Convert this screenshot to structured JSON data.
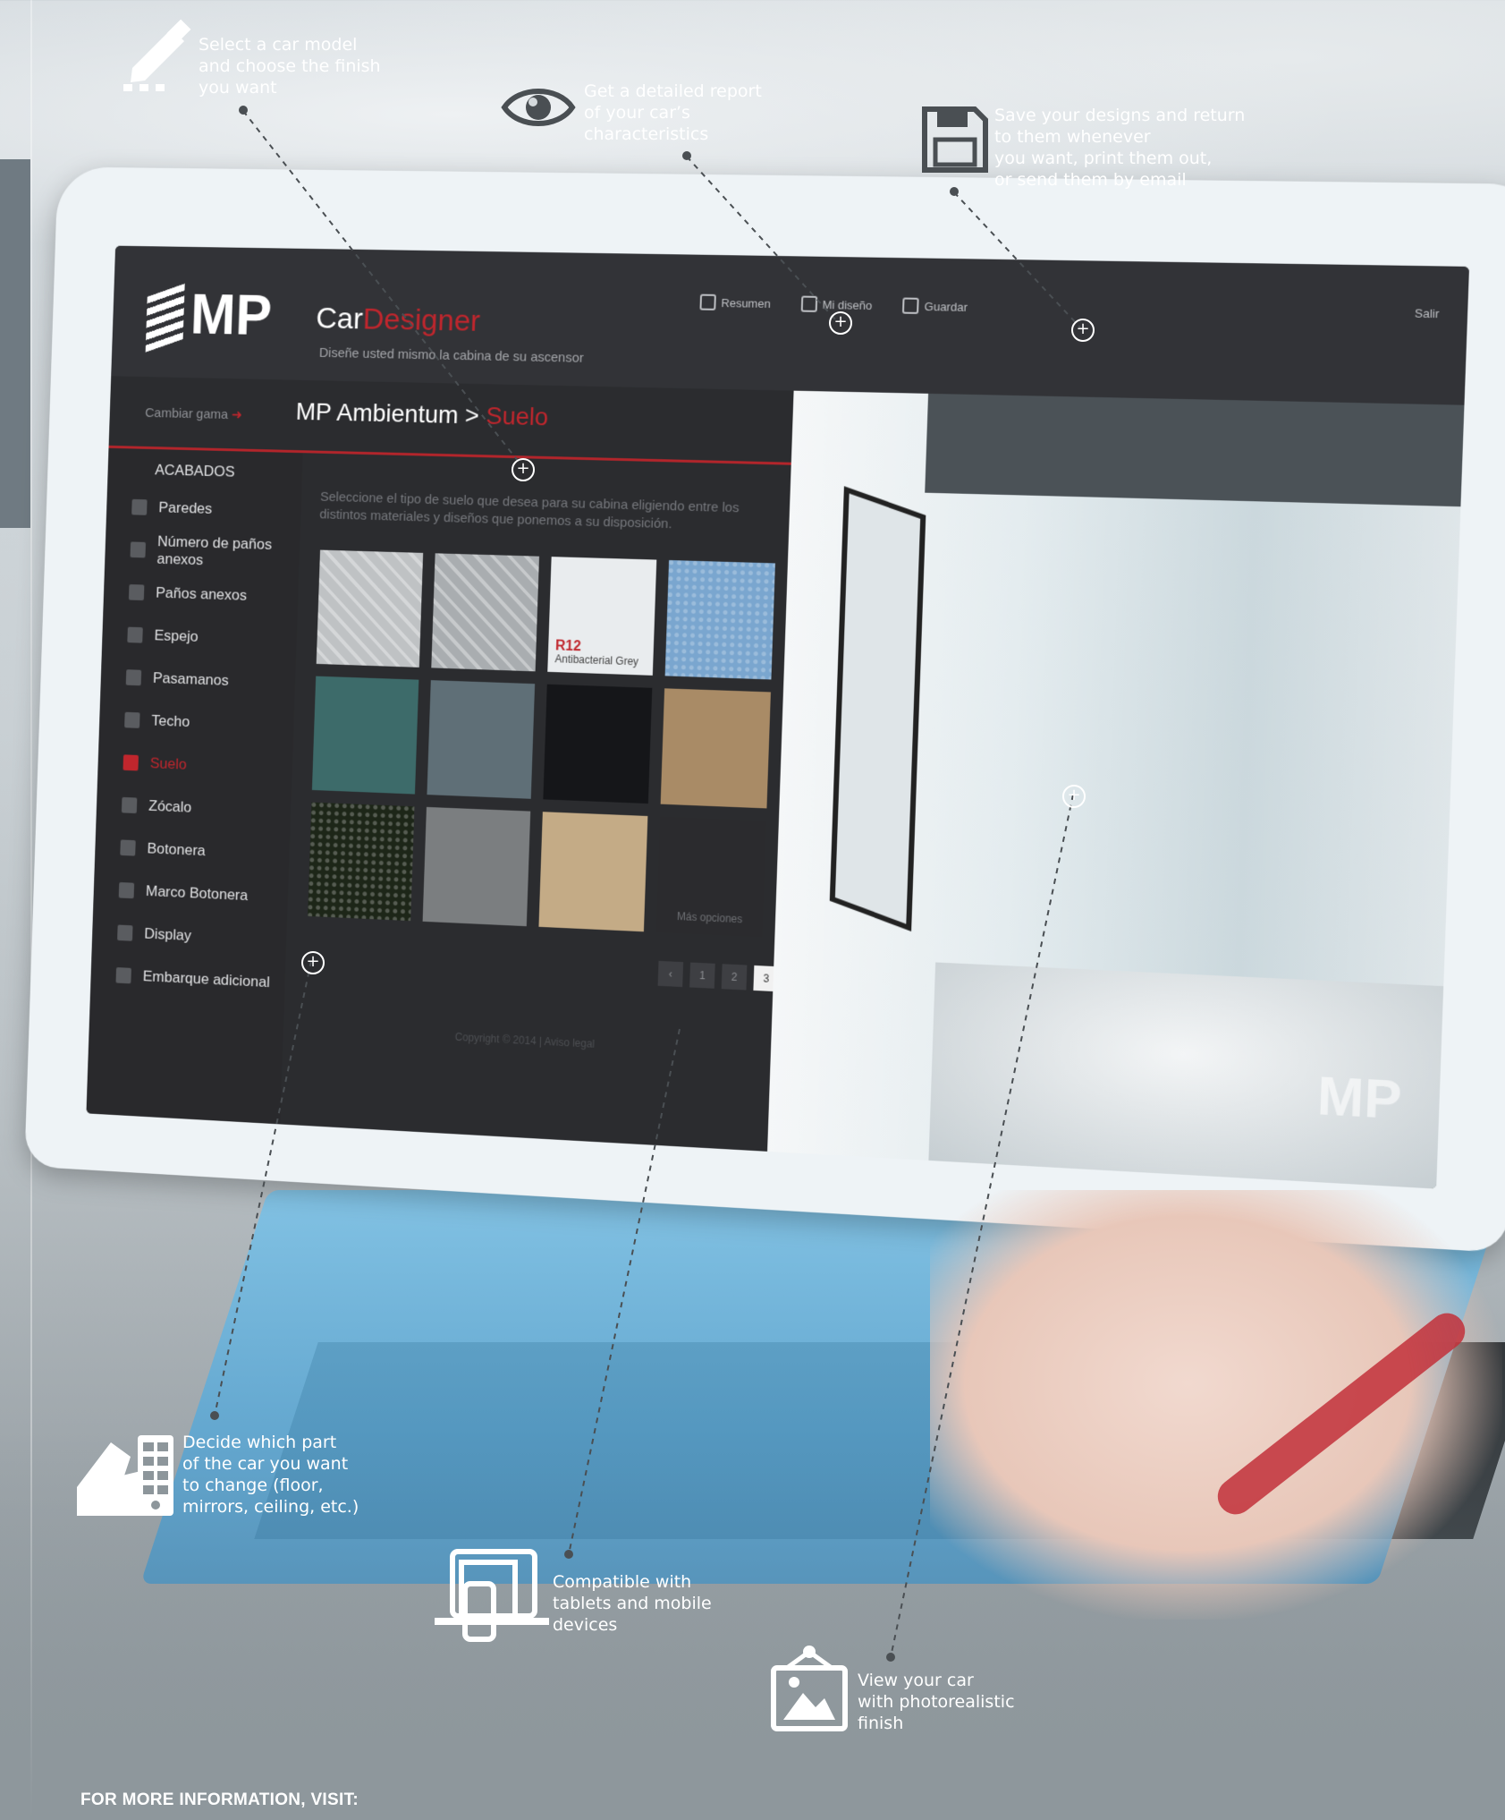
{
  "app": {
    "logo_text": "MP",
    "title_prefix": "Car",
    "title_accent": "Designer",
    "subtitle": "Diseñe usted mismo la cabina de su ascensor",
    "actions": [
      "Resumen",
      "Mi diseño",
      "Guardar"
    ],
    "exit_label": "Salir",
    "range_change_label": "Cambiar gama",
    "range_name": "MP Ambientum",
    "range_section": "Suelo",
    "sidebar_header": "ACABADOS",
    "sidebar_items": [
      {
        "label": "Paredes"
      },
      {
        "label": "Número de paños anexos"
      },
      {
        "label": "Paños anexos"
      },
      {
        "label": "Espejo"
      },
      {
        "label": "Pasamanos"
      },
      {
        "label": "Techo"
      },
      {
        "label": "Suelo",
        "active": true
      },
      {
        "label": "Zócalo"
      },
      {
        "label": "Botonera"
      },
      {
        "label": "Marco Botonera"
      },
      {
        "label": "Display"
      },
      {
        "label": "Embarque adicional"
      }
    ],
    "content_description": "Seleccione el tipo de suelo que desea para su cabina eligiendo entre los distintos materiales y diseños que ponemos a su disposición.",
    "finishes": [
      {
        "color": "#bfc2c4",
        "pattern": "checker"
      },
      {
        "color": "#a9adb0",
        "pattern": "checker"
      },
      {
        "color": "#e9ecee",
        "label_code": "R12",
        "label_text": "Antibacterial Grey"
      },
      {
        "color": "#7aa6cf",
        "pattern": "speckle"
      },
      {
        "color": "#3d6b6a"
      },
      {
        "color": "#5f6f77"
      },
      {
        "color": "#151619"
      },
      {
        "color": "#a98b66"
      },
      {
        "color": "#1d2618",
        "pattern": "speckle"
      },
      {
        "color": "#7b7e80"
      },
      {
        "color": "#c4ab86"
      },
      {
        "color": "#2b2b2e",
        "more_label": "Más opciones"
      }
    ],
    "pager": [
      "‹",
      "1",
      "2",
      "3",
      "›"
    ],
    "pager_active": "3",
    "copyright": "Copyright © 2014 | Aviso legal"
  },
  "callouts": {
    "select_model": "Select a car model\nand choose the finish\nyou want",
    "report": "Get a detailed report\nof your car’s\ncharacteristics",
    "save": "Save your designs and return\nto them whenever\nyou want, print them out,\nor send them by email",
    "decide_part": "Decide which part\nof the car you want\nto change (floor,\nmirrors, ceiling, etc.)",
    "compatible": "Compatible with\ntablets and mobile\ndevices",
    "view_car": "View your car\nwith photorealistic\nfinish"
  },
  "icons": {
    "select_model": "pencil-icon",
    "report": "eye-icon",
    "save": "floppy-disk-icon",
    "decide_part": "swatch-icon",
    "compatible": "devices-icon",
    "view_car": "picture-icon"
  },
  "footer": {
    "text": "FOR MORE INFORMATION, VISIT:"
  },
  "colors": {
    "accent": "#c0262d",
    "keyboard": "#5aa8d6"
  }
}
